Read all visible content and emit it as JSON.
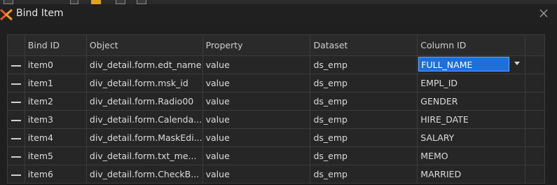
{
  "window": {
    "title": "Bind Item",
    "icons": {
      "app": "app-logo-icon",
      "close": "close-icon",
      "dropdown": "chevron-down-icon"
    }
  },
  "columns": [
    "Bind ID",
    "Object",
    "Property",
    "Dataset",
    "Column ID"
  ],
  "rows": [
    {
      "bind_id": "item0",
      "object": "div_detail.form.edt_name",
      "property": "value",
      "dataset": "ds_emp",
      "column_id": "FULL_NAME"
    },
    {
      "bind_id": "item1",
      "object": "div_detail.form.msk_id",
      "property": "value",
      "dataset": "ds_emp",
      "column_id": "EMPL_ID"
    },
    {
      "bind_id": "item2",
      "object": "div_detail.form.Radio00",
      "property": "value",
      "dataset": "ds_emp",
      "column_id": "GENDER"
    },
    {
      "bind_id": "item3",
      "object": "div_detail.form.Calenda...",
      "property": "value",
      "dataset": "ds_emp",
      "column_id": "HIRE_DATE"
    },
    {
      "bind_id": "item4",
      "object": "div_detail.form.MaskEdi...",
      "property": "value",
      "dataset": "ds_emp",
      "column_id": "SALARY"
    },
    {
      "bind_id": "item5",
      "object": "div_detail.form.txt_me...",
      "property": "value",
      "dataset": "ds_emp",
      "column_id": "MEMO"
    },
    {
      "bind_id": "item6",
      "object": "div_detail.form.CheckB...",
      "property": "value",
      "dataset": "ds_emp",
      "column_id": "MARRIED"
    }
  ],
  "colors": {
    "selection": "#1e6fd9",
    "background": "#1f1f1f",
    "accent": "#e6a21b"
  }
}
